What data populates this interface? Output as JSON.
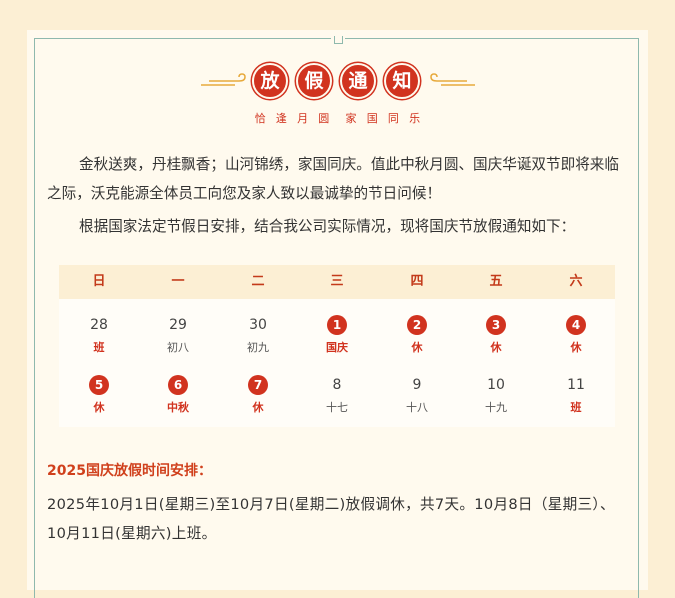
{
  "title_chars": [
    "放",
    "假",
    "通",
    "知"
  ],
  "subtitle_chars": [
    "恰",
    "逢",
    "月",
    "圆",
    "家",
    "国",
    "同",
    "乐"
  ],
  "intro_paragraph": "金秋送爽，丹桂飘香；山河锦绣，家国同庆。值此中秋月圆、国庆华诞双节即将来临之际，沃克能源全体员工向您及家人致以最诚挚的节日问候！",
  "basis_paragraph": "根据国家法定节假日安排，结合我公司实际情况，现将国庆节放假通知如下：",
  "calendar": {
    "weekdays": [
      "日",
      "一",
      "二",
      "三",
      "四",
      "五",
      "六"
    ],
    "weeks": [
      [
        {
          "num": "28",
          "sub": "班",
          "highlight": false,
          "red": true
        },
        {
          "num": "29",
          "sub": "初八",
          "highlight": false,
          "red": false
        },
        {
          "num": "30",
          "sub": "初九",
          "highlight": false,
          "red": false
        },
        {
          "num": "1",
          "sub": "国庆",
          "highlight": true,
          "red": true
        },
        {
          "num": "2",
          "sub": "休",
          "highlight": true,
          "red": true
        },
        {
          "num": "3",
          "sub": "休",
          "highlight": true,
          "red": true
        },
        {
          "num": "4",
          "sub": "休",
          "highlight": true,
          "red": true
        }
      ],
      [
        {
          "num": "5",
          "sub": "休",
          "highlight": true,
          "red": true
        },
        {
          "num": "6",
          "sub": "中秋",
          "highlight": true,
          "red": true
        },
        {
          "num": "7",
          "sub": "休",
          "highlight": true,
          "red": true
        },
        {
          "num": "8",
          "sub": "十七",
          "highlight": false,
          "red": false
        },
        {
          "num": "9",
          "sub": "十八",
          "highlight": false,
          "red": false
        },
        {
          "num": "10",
          "sub": "十九",
          "highlight": false,
          "red": false
        },
        {
          "num": "11",
          "sub": "班",
          "highlight": false,
          "red": true
        }
      ]
    ]
  },
  "arrangement_title": "2025国庆放假时间安排：",
  "arrangement_text": "2025年10月1日(星期三)至10月7日(星期二)放假调休，共7天。10月8日（星期三）、10月11日(星期六)上班。",
  "colors": {
    "accent_red": "#d1331f",
    "frame_green": "#8fb9ad",
    "header_cream": "#fcefd4"
  }
}
